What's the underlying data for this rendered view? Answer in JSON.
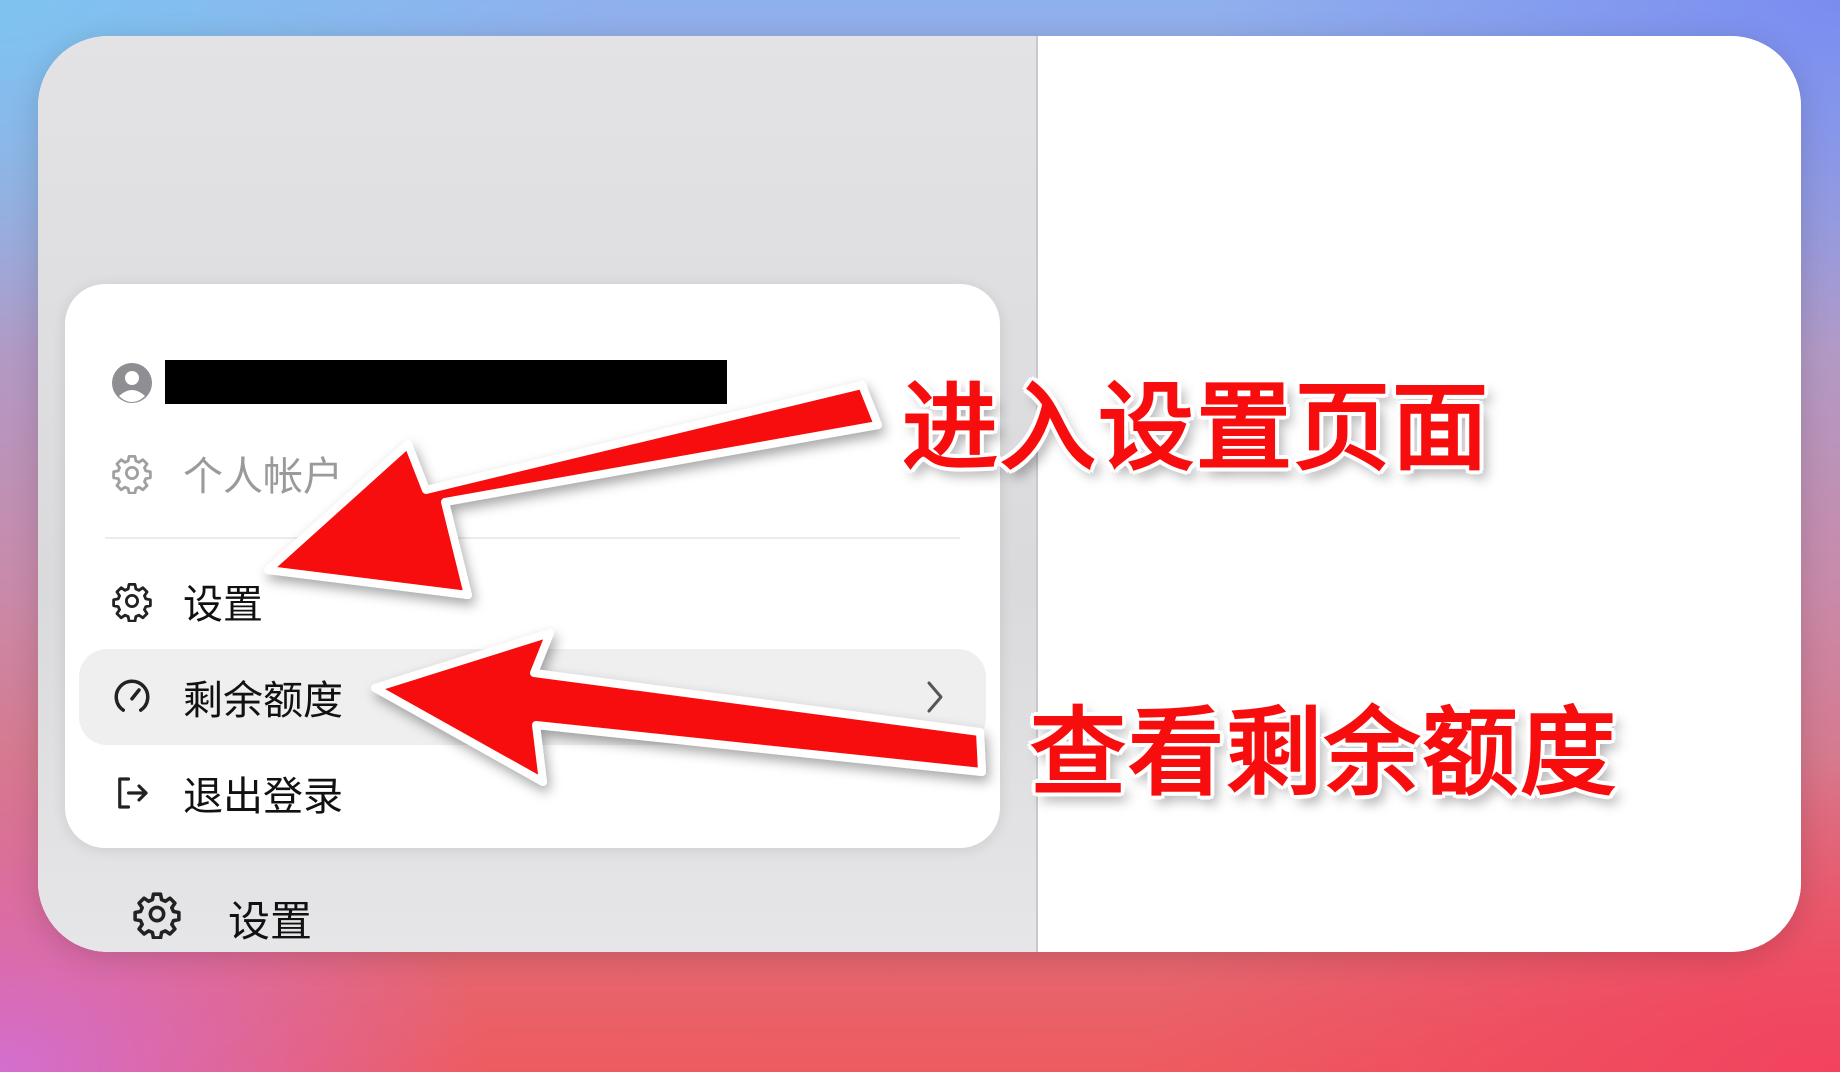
{
  "menu": {
    "account_label": "个人帐户",
    "settings_label": "设置",
    "quota_label": "剩余额度",
    "logout_label": "退出登录"
  },
  "sidebar": {
    "settings_label": "设置"
  },
  "annotations": {
    "settings_note": "进入设置页面",
    "quota_note": "查看剩余额度"
  },
  "colors": {
    "annotation_red": "#f70d0d",
    "menu_highlight": "#efeff0"
  },
  "icons": [
    "user-avatar-icon",
    "gear-icon",
    "gauge-icon",
    "chevron-right-icon",
    "logout-icon"
  ]
}
